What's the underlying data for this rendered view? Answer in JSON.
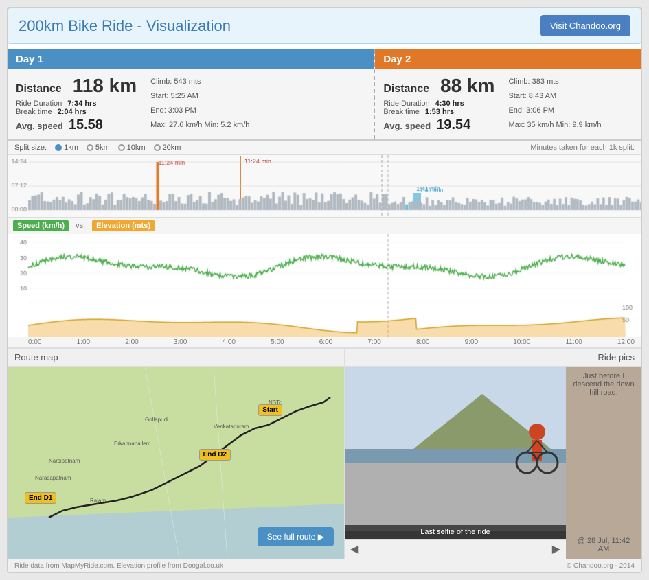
{
  "header": {
    "title": "200km Bike Ride - Visualization",
    "visit_btn": "Visit Chandoo.org"
  },
  "day1": {
    "label": "Day 1",
    "distance_label": "Distance",
    "distance_value": "118 km",
    "climb": "Climb: 543 mts",
    "ride_duration_label": "Ride Duration",
    "ride_duration_value": "7:34 hrs",
    "break_time_label": "Break time",
    "break_time_value": "2:04 hrs",
    "avg_speed_label": "Avg. speed",
    "avg_speed_value": "15.58",
    "start": "Start: 5:25 AM",
    "end": "End: 3:03 PM",
    "max_min": "Max: 27.6 km/h  Min: 5.2 km/h"
  },
  "day2": {
    "label": "Day 2",
    "distance_label": "Distance",
    "distance_value": "88 km",
    "climb": "Climb: 383 mts",
    "ride_duration_label": "Ride Duration",
    "ride_duration_value": "4:30 hrs",
    "break_time_label": "Break time",
    "break_time_value": "1:53 hrs",
    "avg_speed_label": "Avg. speed",
    "avg_speed_value": "19.54",
    "start": "Start: 8:43 AM",
    "end": "End: 3:06 PM",
    "max_min": "Max: 35 km/h  Min: 9.9 km/h"
  },
  "split": {
    "label": "Split size:",
    "options": [
      "1km",
      "5km",
      "10km",
      "20km"
    ],
    "selected": "1km",
    "right_label": "Minutes taken for each 1k split."
  },
  "bar_chart": {
    "callout1": "11:24 min",
    "callout2": "1:41 min",
    "y_labels": [
      "14:24",
      "07:12",
      "00:00"
    ]
  },
  "speed_chart": {
    "legend_speed": "Speed (km/h)",
    "legend_vs": "vs.",
    "legend_elev": "Elevation (mts)",
    "y_speed": [
      "40",
      "30",
      "20",
      "10"
    ],
    "y_elev": [
      "100",
      "50"
    ]
  },
  "time_axis": {
    "labels": [
      "0:00",
      "1:00",
      "2:00",
      "3:00",
      "4:00",
      "5:00",
      "6:00",
      "7:00",
      "8:00",
      "9:00",
      "10:00",
      "11:00",
      "12:00"
    ]
  },
  "bottom": {
    "route_map_label": "Route map",
    "ride_pics_label": "Ride pics",
    "see_full_route": "See full route ▶",
    "markers": {
      "start": "Start",
      "end_d2": "End D2",
      "end_d1": "End D1"
    },
    "pic_caption": "Last selfie of the ride",
    "pic_side_text": "Just before I descend the down hill road.",
    "pic_side_date": "@ 28 Jul, 11:42 AM"
  },
  "footer": {
    "left": "Ride data from MapMyRide.com. Elevation profile from Doogal.co.uk",
    "right": "© Chandoo.org - 2014"
  }
}
